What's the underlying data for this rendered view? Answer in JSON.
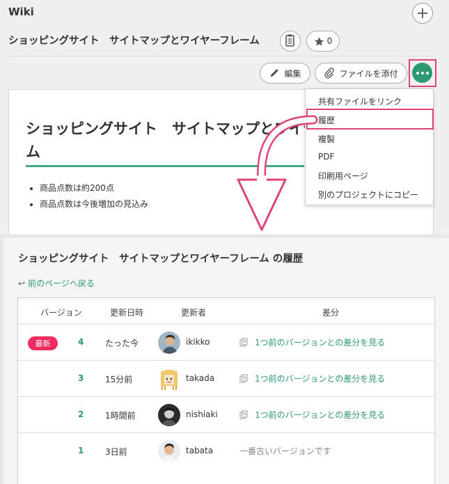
{
  "top": {
    "wiki_label": "Wiki",
    "page_title": "ショッピングサイト　サイトマップとワイヤーフレーム",
    "star_count": "0",
    "edit_label": "編集",
    "attach_label": "ファイルを添付",
    "doc": {
      "heading_line1": "ショッピングサイト　サイトマップとワイヤーフレー",
      "heading_line2": "ム",
      "bullets": [
        "商品点数は約200点",
        "商品点数は今後増加の見込み"
      ]
    },
    "menu": {
      "items": [
        "共有ファイルをリンク",
        "履歴",
        "複製",
        "PDF",
        "印刷用ページ",
        "別のプロジェクトにコピー"
      ]
    }
  },
  "history": {
    "title": "ショッピングサイト　サイトマップとワイヤーフレーム の履歴",
    "back_label": "前のページへ戻る",
    "headers": {
      "version": "バージョン",
      "updated": "更新日時",
      "updater": "更新者",
      "diff": "差分"
    },
    "rows": [
      {
        "badge": "最新",
        "version": "4",
        "date": "たった今",
        "user": "ikikko",
        "diff": "1つ前のバージョンとの差分を見る"
      },
      {
        "version": "3",
        "date": "15分前",
        "user": "takada",
        "diff": "1つ前のバージョンとの差分を見る"
      },
      {
        "version": "2",
        "date": "1時間前",
        "user": "nishiaki",
        "diff": "1つ前のバージョンとの差分を見る"
      },
      {
        "version": "1",
        "date": "3日前",
        "user": "tabata",
        "diff": "一番古いバージョンです"
      }
    ]
  },
  "colors": {
    "accent_green": "#2e9a72",
    "highlight_pink": "#e0427a",
    "badge_red": "#f02b5d"
  },
  "icons": {
    "add": "plus-icon",
    "clipboard": "clipboard-icon",
    "star": "star-icon",
    "edit": "pencil-icon",
    "attach": "paperclip-icon",
    "more": "ellipsis-icon",
    "back": "back-arrow-icon",
    "diff": "document-icon"
  }
}
